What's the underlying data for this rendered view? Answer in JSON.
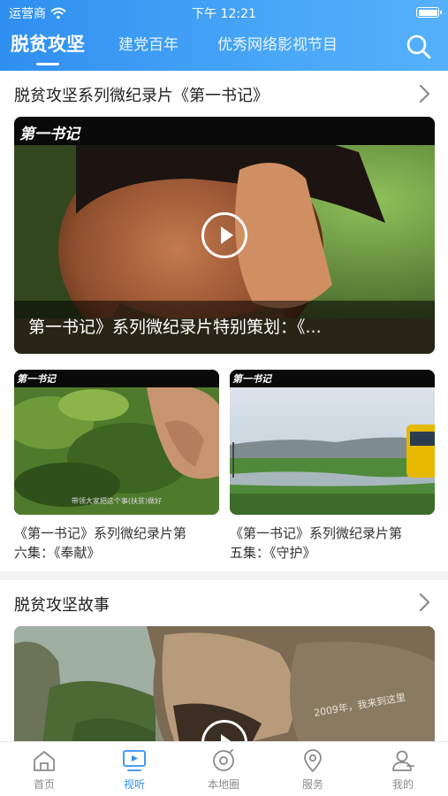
{
  "status_bar": {
    "carrier": "运营商",
    "time": "下午 12:21"
  },
  "header": {
    "tabs": [
      {
        "label": "脱贫攻坚",
        "active": true
      },
      {
        "label": "建党百年",
        "active": false
      },
      {
        "label": "优秀网络影视节目",
        "active": false
      }
    ],
    "search_icon": "search-icon"
  },
  "section1": {
    "title": "脱贫攻坚系列微纪录片《第一书记》",
    "featured": {
      "logo": "第一书记",
      "caption": "第一书记》系列微纪录片特别策划：《..."
    },
    "cards": [
      {
        "logo": "第一书记",
        "subtitle": "带领大家把这个事(扶贫)做好",
        "title_line1": "《第一书记》系列微纪录片第",
        "title_line2": "六集：《奉献》"
      },
      {
        "logo": "第一书记",
        "title_line1": "《第一书记》系列微纪录片第",
        "title_line2": "五集：《守护》"
      }
    ]
  },
  "section2": {
    "title": "脱贫攻坚故事",
    "featured": {
      "overlay_text": "2009年，我来到这里"
    }
  },
  "bottom_nav": [
    {
      "label": "首页",
      "icon": "home-icon",
      "active": false
    },
    {
      "label": "视听",
      "icon": "tv-icon",
      "active": true
    },
    {
      "label": "本地圈",
      "icon": "local-circle-icon",
      "active": false
    },
    {
      "label": "服务",
      "icon": "location-pin-icon",
      "active": false
    },
    {
      "label": "我的",
      "icon": "user-icon",
      "active": false
    }
  ],
  "colors": {
    "accent": "#2f8ff0",
    "nav_inactive": "#8a8a8a",
    "header_gradient_start": "#2f8ff0",
    "header_gradient_end": "#56b1fb"
  }
}
